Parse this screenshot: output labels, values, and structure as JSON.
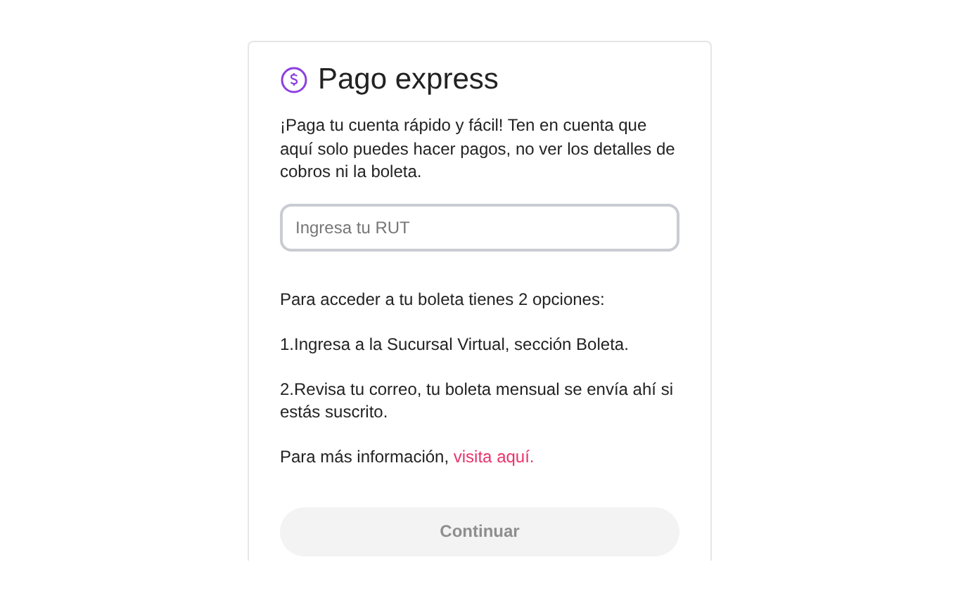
{
  "card": {
    "title": "Pago express",
    "intro": "¡Paga tu cuenta rápido y fácil! Ten en cuenta que aquí solo puedes hacer pagos, no ver los detalles de cobros ni la boleta.",
    "rut_field": {
      "placeholder": "Ingresa tu RUT"
    },
    "paragraphs": [
      "Para acceder a tu boleta tienes 2 opciones:",
      "1.Ingresa a la Sucursal Virtual, sección Boleta.",
      "2.Revisa tu correo, tu boleta mensual se envía ahí si estás suscrito."
    ],
    "more_info": {
      "text": "Para más información,",
      "link": "visita aquí."
    },
    "continue_button": {
      "label": "Continuar",
      "disabled": true
    }
  }
}
